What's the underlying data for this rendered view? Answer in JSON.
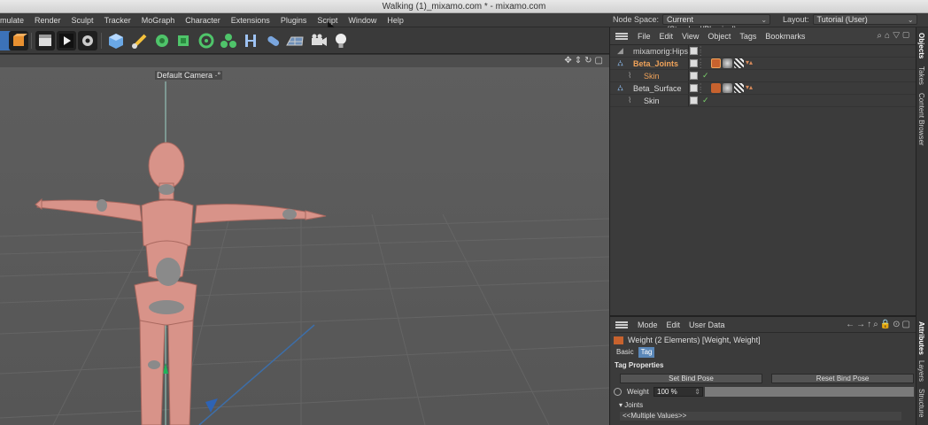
{
  "window": {
    "title": "Walking (1)_mixamo.com * - mixamo.com"
  },
  "menubar": {
    "items": [
      "mulate",
      "Render",
      "Sculpt",
      "Tracker",
      "MoGraph",
      "Character",
      "Extensions",
      "Plugins",
      "Script",
      "Window",
      "Help"
    ],
    "node_space_label": "Node Space:",
    "node_space_value": "Current (Standard/Physical)",
    "layout_label": "Layout:",
    "layout_value": "Tutorial (User)"
  },
  "viewport": {
    "camera_label": "Default Camera ·°"
  },
  "object_manager": {
    "menu": [
      "File",
      "Edit",
      "View",
      "Object",
      "Tags",
      "Bookmarks"
    ],
    "rows": [
      {
        "name": "mixamorig:Hips",
        "color": "#cfcfcf",
        "indent": 1
      },
      {
        "name": "Beta_Joints",
        "color": "#f0a35a",
        "indent": 1
      },
      {
        "name": "Skin",
        "color": "#f0a35a",
        "indent": 2
      },
      {
        "name": "Beta_Surface",
        "color": "#dcdcdc",
        "indent": 1
      },
      {
        "name": "Skin",
        "color": "#dcdcdc",
        "indent": 2
      }
    ]
  },
  "side_tabs": [
    "Objects",
    "Takes",
    "Content Browser",
    "Attributes",
    "Layers",
    "Structure"
  ],
  "attributes": {
    "menu": [
      "Mode",
      "Edit",
      "User Data"
    ],
    "title": "Weight (2 Elements) [Weight, Weight]",
    "tabs": [
      "Basic",
      "Tag"
    ],
    "section": "Tag Properties",
    "set_bind_pose": "Set Bind Pose",
    "reset_bind_pose": "Reset Bind Pose",
    "weight_label": "Weight",
    "weight_value": "100 %",
    "joints_label": "▾ Joints",
    "multiple_values": "<<Multiple Values>>"
  },
  "colors": {
    "accent": "#5a87b8",
    "selected_object": "#f0a35a",
    "skin_figure": "#d89389"
  }
}
